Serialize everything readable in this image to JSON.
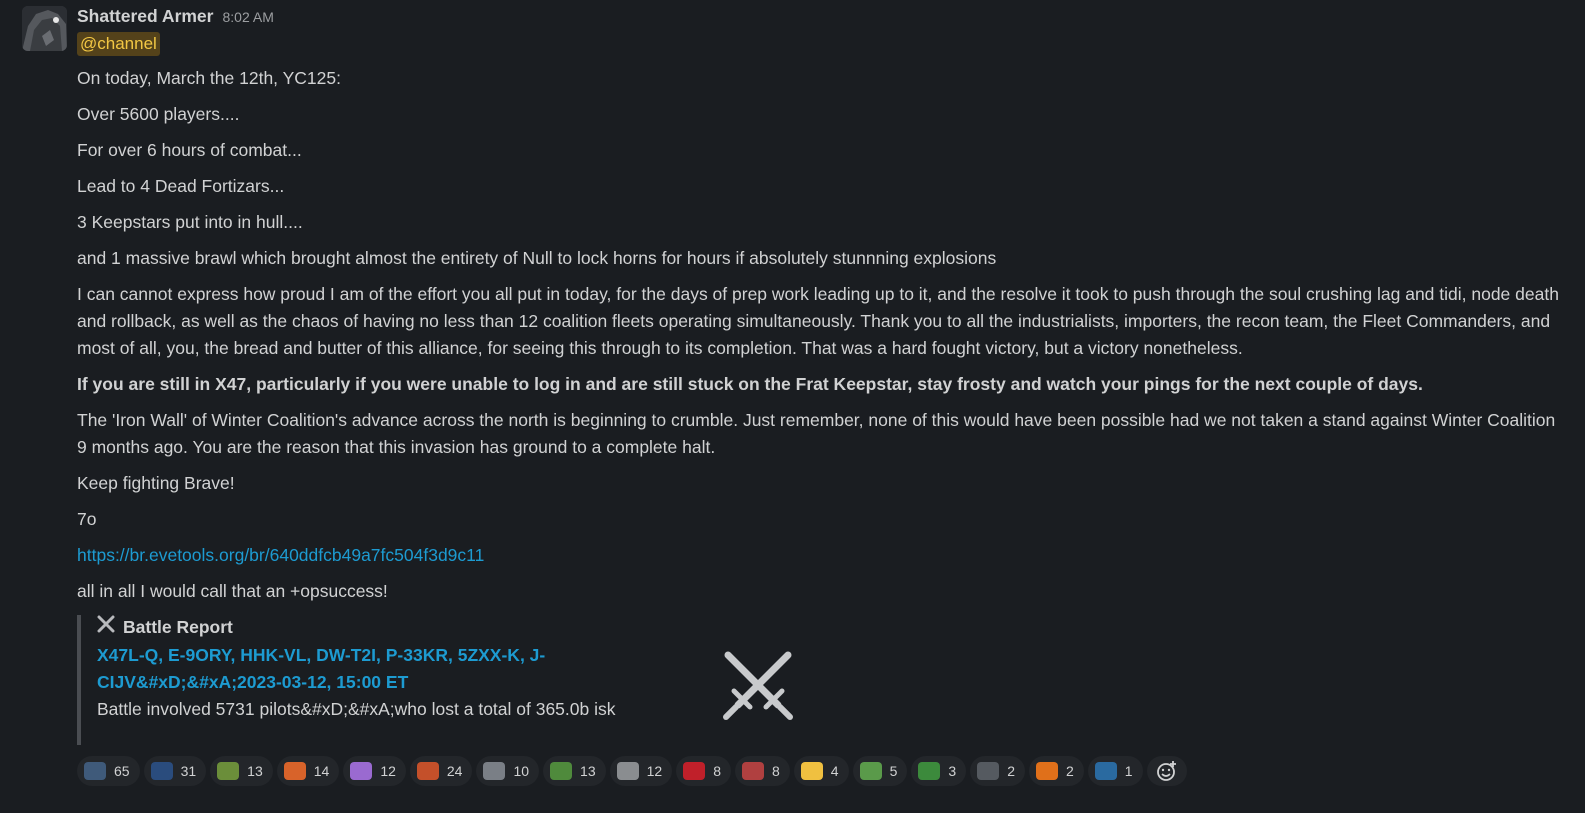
{
  "message": {
    "author": "Shattered Armer",
    "time": "8:02 AM",
    "mention": "@channel",
    "paragraphs": [
      "On today, March the 12th, YC125:",
      "Over 5600 players....",
      "For over 6 hours of combat...",
      "Lead to 4 Dead Fortizars...",
      "3 Keepstars put into in hull....",
      "and 1 massive brawl which brought almost the entirety of Null to lock horns for hours if absolutely stunnning explosions",
      "I can cannot express how proud I am of the effort you all put in today, for the days of prep work leading up to it, and the resolve it took to push through the soul crushing lag and tidi, node death and rollback, as well as the chaos of having no less than 12 coalition fleets operating simultaneously. Thank you to all the industrialists, importers, the recon team, the Fleet Commanders, and most of all, you, the bread and butter of this alliance, for seeing this through to its completion. That was a hard fought victory, but a victory nonetheless.",
      "If you are still in X47, particularly if you were unable to log in and are still stuck on the Frat Keepstar, stay frosty and watch your pings for the next couple of days.",
      "The 'Iron Wall' of Winter Coalition's advance across the north is beginning to crumble.  Just remember, none of this would have been possible had we not taken a stand against Winter Coalition 9 months ago. You are the reason that this invasion has ground to a complete halt.",
      "Keep fighting Brave!",
      "7o"
    ],
    "link": "https://br.evetools.org/br/640ddfcb49a7fc504f3d9c11",
    "closing": " all in all I would call that an +opsuccess!"
  },
  "attachment": {
    "title": "Battle Report",
    "link_text": "X47L-Q, E-9ORY, HHK-VL, DW-T2I, P-33KR, 5ZXX-K, J-CIJV&#xD;&#xA;2023-03-12, 15:00 ET",
    "description": "Battle involved 5731 pilots&#xD;&#xA;who lost a total of 365.0b isk",
    "icon": "crossed-swords-icon"
  },
  "reactions": [
    {
      "count": "65",
      "color": "#3f5a7a"
    },
    {
      "count": "31",
      "color": "#2a4c7d"
    },
    {
      "count": "13",
      "color": "#6b8e3a"
    },
    {
      "count": "14",
      "color": "#d8632a"
    },
    {
      "count": "12",
      "color": "#9a6ad0"
    },
    {
      "count": "24",
      "color": "#c4502a"
    },
    {
      "count": "10",
      "color": "#7a7f86"
    },
    {
      "count": "13",
      "color": "#4f8a3c"
    },
    {
      "count": "12",
      "color": "#8a8d90"
    },
    {
      "count": "8",
      "color": "#c0202a"
    },
    {
      "count": "8",
      "color": "#b04040"
    },
    {
      "count": "4",
      "color": "#f0c040"
    },
    {
      "count": "5",
      "color": "#5a9a4a"
    },
    {
      "count": "3",
      "color": "#3c8a3c"
    },
    {
      "count": "2",
      "color": "#555a60"
    },
    {
      "count": "2",
      "color": "#e0701a"
    },
    {
      "count": "1",
      "color": "#2a6aa0"
    }
  ],
  "add_reaction_icon": "add-reaction-icon"
}
